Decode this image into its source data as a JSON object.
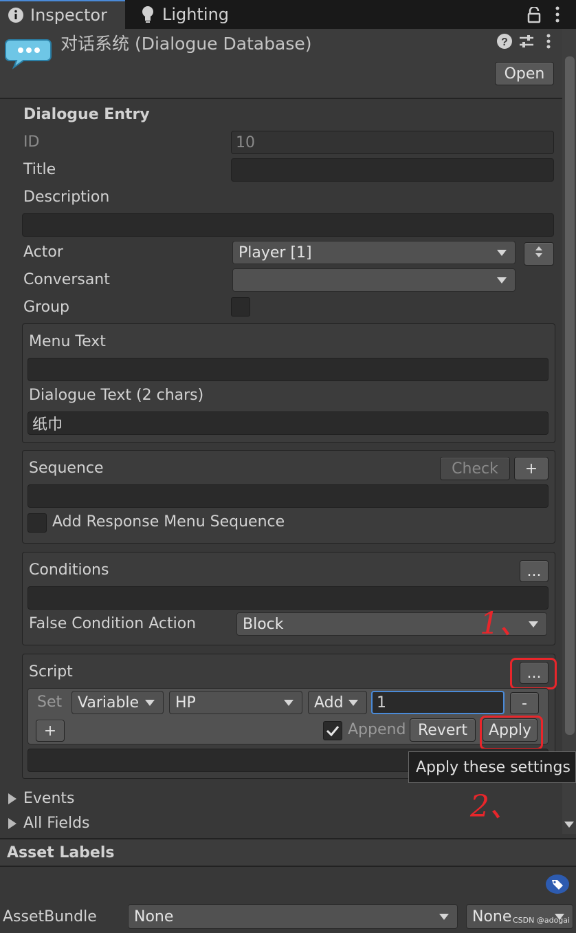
{
  "tabs": [
    {
      "label": "Inspector",
      "icon": "info-icon"
    },
    {
      "label": "Lighting",
      "icon": "lightbulb-icon"
    }
  ],
  "header": {
    "title": "对话系统 (Dialogue Database)",
    "open_label": "Open"
  },
  "entry": {
    "section_title": "Dialogue Entry",
    "id_label": "ID",
    "id_value": "10",
    "title_label": "Title",
    "title_value": "",
    "description_label": "Description",
    "description_value": "",
    "actor_label": "Actor",
    "actor_value": "Player [1]",
    "conversant_label": "Conversant",
    "conversant_value": "",
    "group_label": "Group"
  },
  "text": {
    "menu_label": "Menu Text",
    "menu_value": "",
    "dialogue_label": "Dialogue Text (2 chars)",
    "dialogue_value": "纸巾"
  },
  "sequence": {
    "label": "Sequence",
    "check_label": "Check",
    "add_label": "+",
    "value": "",
    "add_response_label": "Add Response Menu Sequence"
  },
  "conditions": {
    "label": "Conditions",
    "more_label": "...",
    "value": "",
    "false_action_label": "False Condition Action",
    "false_action_value": "Block"
  },
  "script": {
    "label": "Script",
    "more_label": "...",
    "set_label": "Set",
    "type_value": "Variable",
    "var_value": "HP",
    "op_value": "Add",
    "amount_value": "1",
    "remove_label": "-",
    "add_label": "+",
    "append_label": "Append",
    "revert_label": "Revert",
    "apply_label": "Apply",
    "result_value": ""
  },
  "tooltip": "Apply these settings",
  "annotations": {
    "step1": "1、",
    "step2": "2、"
  },
  "foldouts": {
    "events": "Events",
    "all_fields": "All Fields"
  },
  "asset_labels": {
    "title": "Asset Labels"
  },
  "assetbundle": {
    "label": "AssetBundle",
    "value1": "None",
    "value2": "None"
  },
  "watermark": "CSDN @adogai",
  "colors": {
    "accent": "#4a8ad8",
    "highlight": "#e8262b"
  }
}
